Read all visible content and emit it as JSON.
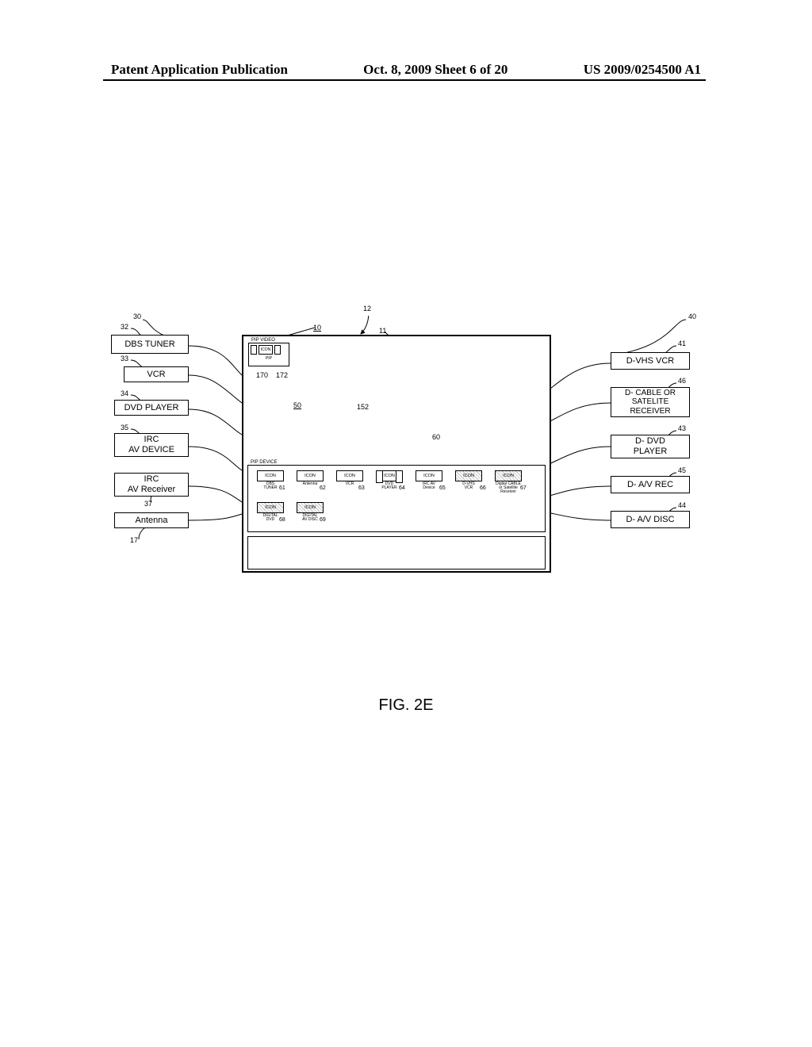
{
  "header": {
    "left": "Patent Application Publication",
    "center": "Oct. 8, 2009  Sheet 6 of 20",
    "right": "US 2009/0254500 A1"
  },
  "figure_caption": "FIG. 2E",
  "left_devices": [
    {
      "ref": "32",
      "label": "DBS TUNER"
    },
    {
      "ref": "33",
      "label": "VCR"
    },
    {
      "ref": "34",
      "label": "DVD PLAYER"
    },
    {
      "ref": "35",
      "label": "IRC\nAV DEVICE"
    },
    {
      "ref": "37",
      "label": "IRC\nAV Receiver"
    },
    {
      "ref": "17",
      "label": "Antenna"
    }
  ],
  "right_devices": [
    {
      "ref": "41",
      "label": "D-VHS VCR"
    },
    {
      "ref": "46",
      "label": "D- CABLE OR\nSATELITE\nRECEIVER"
    },
    {
      "ref": "43",
      "label": "D- DVD\nPLAYER"
    },
    {
      "ref": "45",
      "label": "D- A/V REC"
    },
    {
      "ref": "44",
      "label": "D- A/V DISC"
    }
  ],
  "screen_refs": {
    "left_bracket": "30",
    "right_bracket": "40",
    "display": "10",
    "id11": "11",
    "top_arc": "12",
    "main_area": "50",
    "arrow_152": "152",
    "panel_60": "60",
    "pip_170": "170",
    "pip_172": "172"
  },
  "pip_video": {
    "title": "PIP VIDEO",
    "icon_label": "ICON",
    "sublabel": "PIP"
  },
  "pip_device": {
    "title": "PIP DEVICE",
    "row1": [
      {
        "num": "61",
        "icon": "ICON",
        "sub": "DBS\nTUNER",
        "hatched": false,
        "sides": false
      },
      {
        "num": "62",
        "icon": "ICON",
        "sub": "Antenna",
        "hatched": false,
        "sides": false
      },
      {
        "num": "63",
        "icon": "ICON",
        "sub": "VCR",
        "hatched": false,
        "sides": false
      },
      {
        "num": "64",
        "icon": "ICON",
        "sub": "DVD\nPLAYER",
        "hatched": false,
        "sides": true
      },
      {
        "num": "65",
        "icon": "ICON",
        "sub": "IRC AV\nDevice",
        "hatched": false,
        "sides": false
      },
      {
        "num": "66",
        "icon": "ICON",
        "sub": "D-VHS\nVCR",
        "hatched": true,
        "sides": false
      },
      {
        "num": "67",
        "icon": "ICON",
        "sub": "Digital CABLE\nor Satellite\nReceiver",
        "hatched": true,
        "sides": false
      }
    ],
    "row2": [
      {
        "num": "68",
        "icon": "ICON",
        "sub": "DIGITAL\nDVD",
        "hatched": true,
        "sides": false
      },
      {
        "num": "69",
        "icon": "ICON",
        "sub": "DIGITAL\nAV DISC",
        "hatched": true,
        "sides": false
      }
    ]
  }
}
